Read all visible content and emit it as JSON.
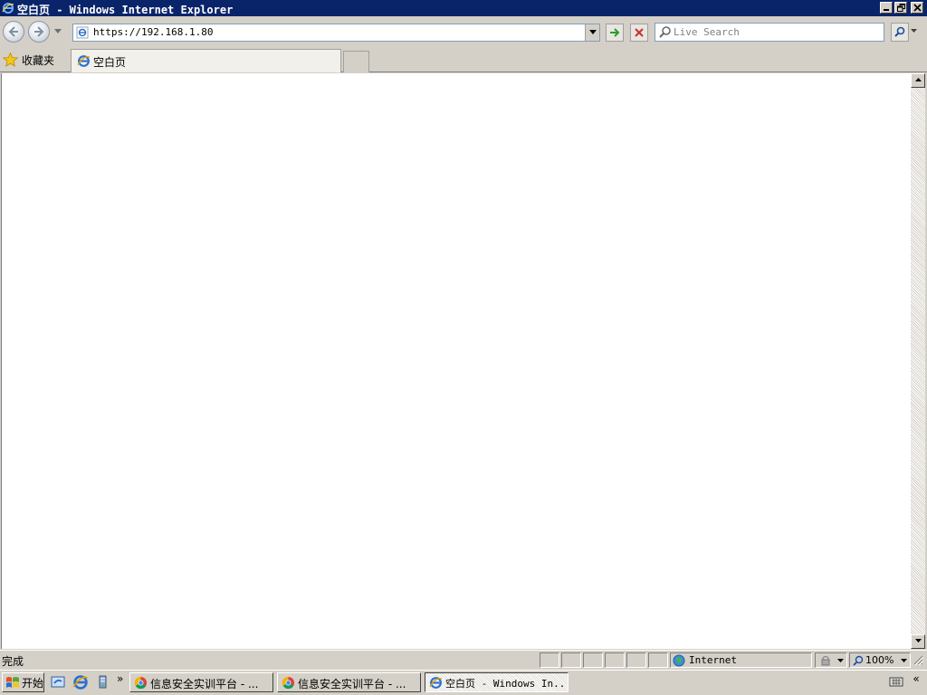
{
  "window": {
    "title": "空白页 - Windows Internet Explorer"
  },
  "nav": {
    "back_label": "Back",
    "forward_label": "Forward",
    "address_value": "https://192.168.1.80",
    "search_placeholder": "Live Search"
  },
  "favorites": {
    "label": "收藏夹"
  },
  "tabs": [
    {
      "label": "空白页",
      "active": true
    }
  ],
  "statusbar": {
    "status_text": "完成",
    "zone_label": "Internet",
    "zoom_level": "100%"
  },
  "taskbar": {
    "start_label": "开始",
    "tasks": [
      {
        "label": "信息安全实训平台 - ...",
        "icon": "chrome-icon",
        "active": false
      },
      {
        "label": "信息安全实训平台 - ...",
        "icon": "chrome-icon",
        "active": false
      },
      {
        "label": "空白页 - Windows In...",
        "icon": "ie-icon",
        "active": true
      }
    ],
    "more_label": "»",
    "tray_expand_label": "«"
  },
  "colors": {
    "titlebar": "#0a246a",
    "chrome": "#d4d0c8",
    "content": "#ffffff",
    "go_arrow": "#2e9a2e",
    "stop_x": "#c8302c"
  }
}
